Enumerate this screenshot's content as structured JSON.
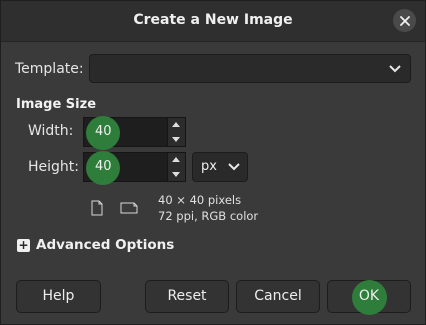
{
  "dialog": {
    "title": "Create a New Image",
    "close_icon": "close-icon"
  },
  "template": {
    "label": "Template:",
    "value": ""
  },
  "image_size": {
    "heading": "Image Size",
    "width_label": "Width:",
    "width_value": "40",
    "height_label": "Height:",
    "height_value": "40",
    "unit": "px",
    "dimensions_text": "40 × 40 pixels",
    "resolution_text": "72 ppi, RGB color"
  },
  "advanced": {
    "label": "Advanced Options"
  },
  "buttons": {
    "help": "Help",
    "reset": "Reset",
    "cancel": "Cancel",
    "ok": "OK"
  },
  "colors": {
    "highlight": "#2f7d3a",
    "dialog_bg": "#3a3a3a"
  }
}
